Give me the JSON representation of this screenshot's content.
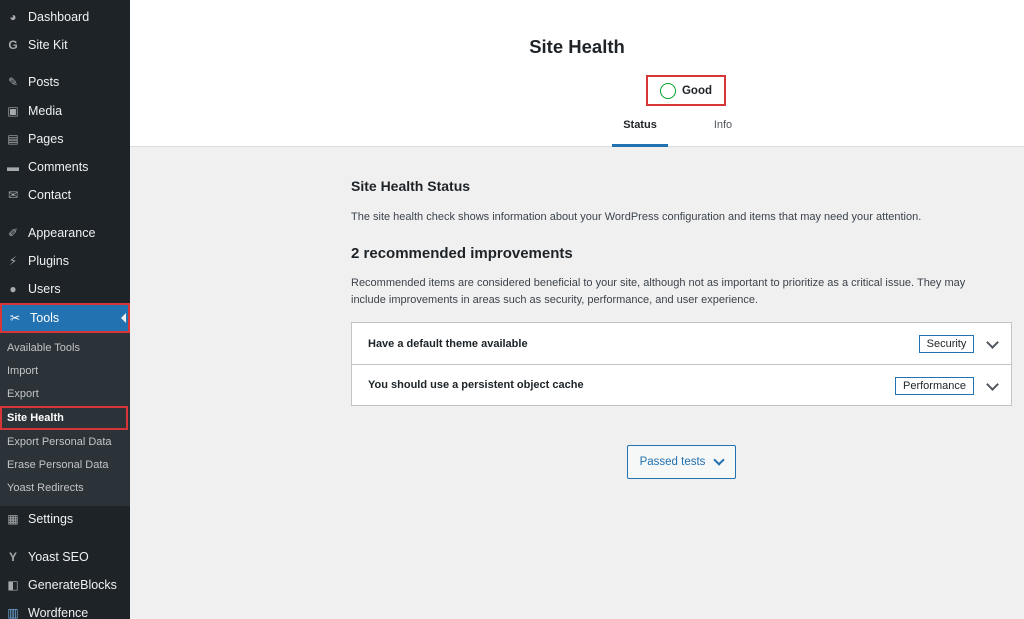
{
  "sidebar": {
    "items": [
      {
        "label": "Dashboard",
        "icon": "dashboard-icon",
        "glyph": "◕"
      },
      {
        "label": "Site Kit",
        "icon": "google-g-icon",
        "glyph": "G"
      },
      {
        "label": "Posts",
        "icon": "pushpin-icon",
        "glyph": "✎"
      },
      {
        "label": "Media",
        "icon": "media-icon",
        "glyph": "▣"
      },
      {
        "label": "Pages",
        "icon": "pages-icon",
        "glyph": "▤"
      },
      {
        "label": "Comments",
        "icon": "comment-icon",
        "glyph": "▬"
      },
      {
        "label": "Contact",
        "icon": "envelope-icon",
        "glyph": "✉"
      },
      {
        "label": "Appearance",
        "icon": "brush-icon",
        "glyph": "✐"
      },
      {
        "label": "Plugins",
        "icon": "plug-icon",
        "glyph": "⚡"
      },
      {
        "label": "Users",
        "icon": "user-icon",
        "glyph": "●"
      },
      {
        "label": "Tools",
        "icon": "wrench-icon",
        "glyph": "✂"
      },
      {
        "label": "Settings",
        "icon": "settings-icon",
        "glyph": "▦"
      },
      {
        "label": "Yoast SEO",
        "icon": "yoast-icon",
        "glyph": "Y"
      },
      {
        "label": "GenerateBlocks",
        "icon": "generateblocks-icon",
        "glyph": "◧"
      },
      {
        "label": "Wordfence",
        "icon": "wordfence-icon",
        "glyph": "▥"
      }
    ],
    "tools_submenu": [
      "Available Tools",
      "Import",
      "Export",
      "Site Health",
      "Export Personal Data",
      "Erase Personal Data",
      "Yoast Redirects"
    ]
  },
  "header": {
    "title": "Site Health",
    "status": "Good",
    "tabs": [
      "Status",
      "Info"
    ]
  },
  "main": {
    "section_title": "Site Health Status",
    "section_desc": "The site health check shows information about your WordPress configuration and items that may need your attention.",
    "improvements_title": "2 recommended improvements",
    "improvements_desc": "Recommended items are considered beneficial to your site, although not as important to prioritize as a critical issue. They may include improvements in areas such as security, performance, and user experience.",
    "issues": [
      {
        "title": "Have a default theme available",
        "badge": "Security"
      },
      {
        "title": "You should use a persistent object cache",
        "badge": "Performance"
      }
    ],
    "passed_tests": "Passed tests"
  },
  "colors": {
    "sidebar_bg": "#1d2327",
    "submenu_bg": "#2c3338",
    "accent": "#2271b1",
    "highlight_border": "#d63638",
    "good": "#00a32a"
  }
}
